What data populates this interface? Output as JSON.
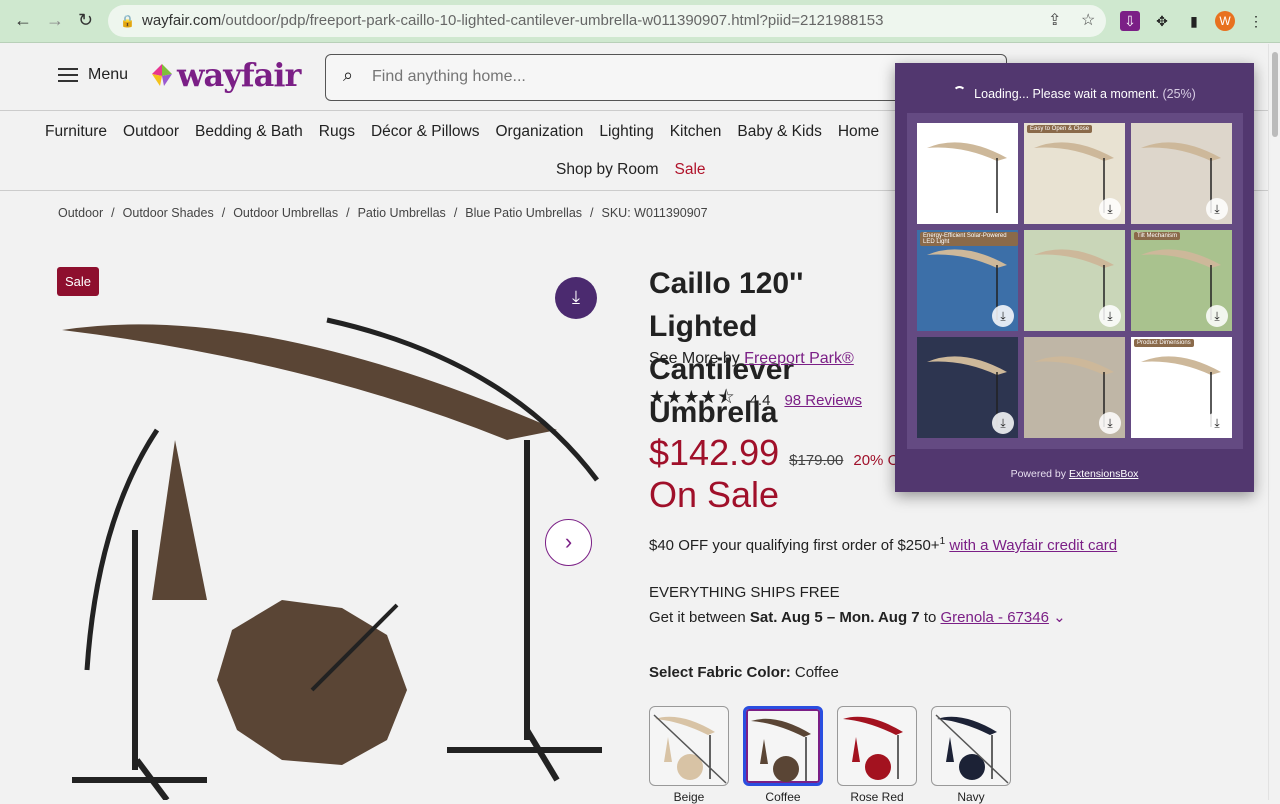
{
  "browser": {
    "url_host": "wayfair.com",
    "url_path": "/outdoor/pdp/freeport-park-caillo-10-lighted-cantilever-umbrella-w011390907.html?piid=2121988153",
    "avatar_letter": "W"
  },
  "header": {
    "menu_label": "Menu",
    "logo_text": "wayfair",
    "search_placeholder": "Find anything home..."
  },
  "categories": [
    "Furniture",
    "Outdoor",
    "Bedding & Bath",
    "Rugs",
    "Décor & Pillows",
    "Organization",
    "Lighting",
    "Kitchen",
    "Baby & Kids",
    "Home"
  ],
  "categories_row2": {
    "shop_by_room": "Shop by Room",
    "sale": "Sale"
  },
  "breadcrumb": [
    "Outdoor",
    "Outdoor Shades",
    "Outdoor Umbrellas",
    "Patio Umbrellas",
    "Blue Patio Umbrellas",
    "SKU: W011390907"
  ],
  "product": {
    "badge": "Sale",
    "title": "Caillo 120'' Lighted Cantilever Umbrella",
    "see_more_prefix": "See More by",
    "brand": "Freeport Park®",
    "rating": 4.4,
    "rating_text": "4.4",
    "reviews": "98 Reviews",
    "price": "$142.99",
    "was_price": "$179.00",
    "discount": "20% Off",
    "on_sale": "On Sale",
    "promo_text": "$40 OFF your qualifying first order of $250+",
    "promo_sup": "1",
    "promo_link": "with a Wayfair credit card",
    "ships": "EVERYTHING SHIPS FREE",
    "get_it_prefix": "Get it between",
    "dates": "Sat. Aug 5 – Mon. Aug 7",
    "to": "to",
    "location": "Grenola - 67346",
    "color_label": "Select Fabric Color:",
    "color_value": "Coffee",
    "swatches": [
      {
        "name": "Beige",
        "color": "#d8c3a5",
        "unavailable": true
      },
      {
        "name": "Coffee",
        "color": "#5a4535",
        "selected": true
      },
      {
        "name": "Rose Red",
        "color": "#a3121f"
      },
      {
        "name": "Navy",
        "color": "#1c2236",
        "unavailable": true
      }
    ]
  },
  "popup": {
    "loading_text": "Loading... Please wait a moment.",
    "progress": "(25%)",
    "powered_prefix": "Powered by",
    "powered_link": "ExtensionsBox",
    "thumb_labels": [
      "",
      "Easy to Open & Close",
      "",
      "Energy-Efficient Solar-Powered LED Light",
      "",
      "Tilt Mechanism",
      "",
      "",
      "Product Dimensions"
    ]
  }
}
